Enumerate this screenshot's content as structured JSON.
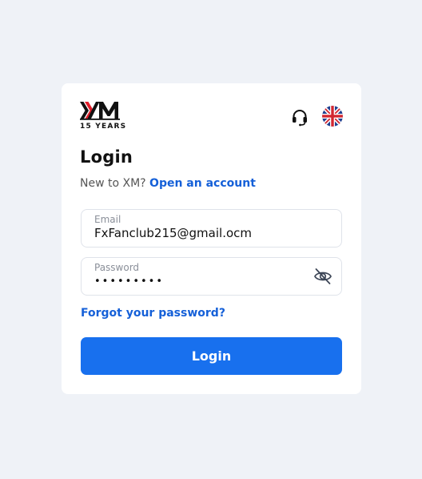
{
  "brand": {
    "logo_text": "XM",
    "tagline": "15 YEARS",
    "colors": {
      "logo_black": "#111111",
      "logo_red": "#e11d2a"
    }
  },
  "header": {
    "support_icon": "headset-icon",
    "language_icon": "uk-flag-icon"
  },
  "form": {
    "title": "Login",
    "signup_prompt": "New to XM?",
    "signup_link": "Open an account",
    "email": {
      "label": "Email",
      "value": "FxFanclub215@gmail.ocm"
    },
    "password": {
      "label": "Password",
      "value": "•••••••••",
      "toggle_icon": "eye-slash-icon"
    },
    "forgot_link": "Forgot your password?",
    "submit_label": "Login"
  },
  "colors": {
    "page_bg": "#eff2f7",
    "card_bg": "#ffffff",
    "accent": "#1870ee",
    "link": "#1560d8"
  }
}
